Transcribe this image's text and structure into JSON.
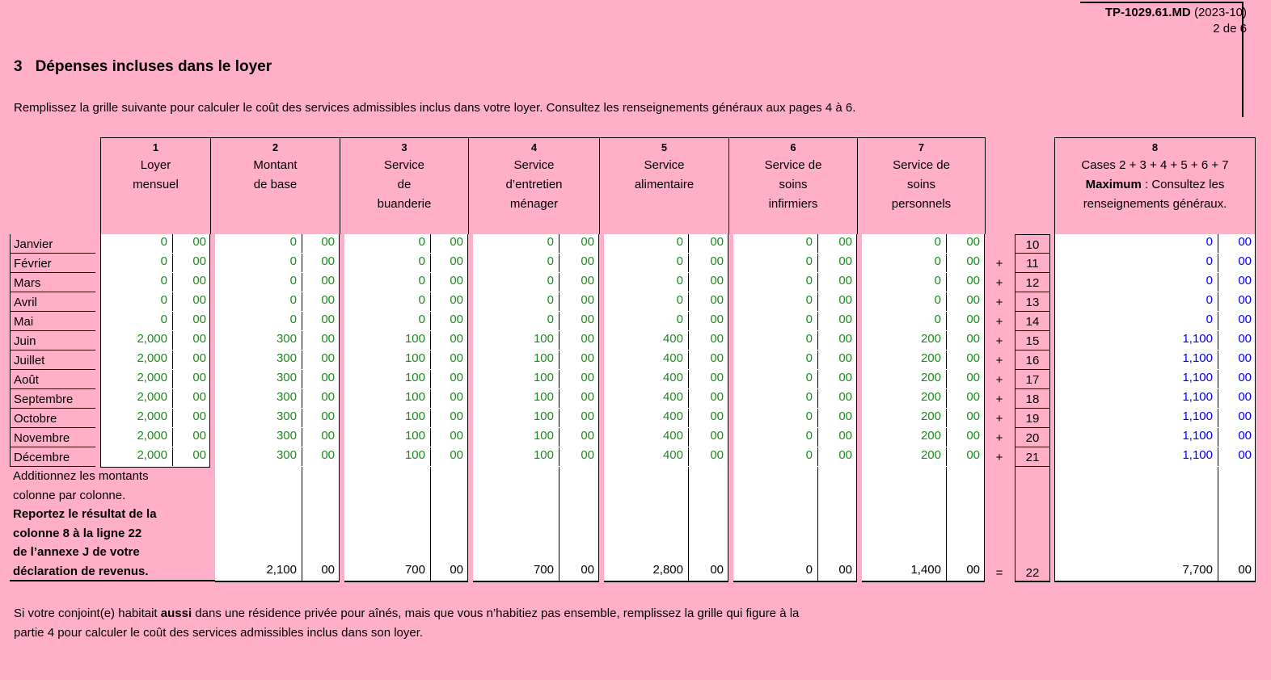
{
  "form": {
    "code": "TP-1029.61.MD",
    "date": "(2023-10)",
    "page": "2 de 6"
  },
  "section": {
    "number": "3",
    "title": "Dépenses incluses dans le loyer",
    "intro": "Remplissez la grille suivante pour calculer le coût des services admissibles inclus dans votre loyer. Consultez les renseignements généraux aux pages 4 à 6."
  },
  "columns": [
    {
      "num": "1",
      "lines": [
        "Loyer",
        "mensuel"
      ]
    },
    {
      "num": "2",
      "lines": [
        "Montant",
        "de base"
      ]
    },
    {
      "num": "3",
      "lines": [
        "Service",
        "de",
        "buanderie"
      ]
    },
    {
      "num": "4",
      "lines": [
        "Service",
        "d’entretien",
        "ménager"
      ]
    },
    {
      "num": "5",
      "lines": [
        "Service",
        "alimentaire"
      ]
    },
    {
      "num": "6",
      "lines": [
        "Service de",
        "soins",
        "infirmiers"
      ]
    },
    {
      "num": "7",
      "lines": [
        "Service de",
        "soins",
        "personnels"
      ]
    }
  ],
  "col8": {
    "num": "8",
    "line1": "Cases 2 + 3 + 4 + 5 + 6 + 7",
    "bold": "Maximum",
    "line2rest": " : Consultez les",
    "line3": "renseignements généraux."
  },
  "rows": [
    {
      "month": "Janvier",
      "line": "10",
      "op": "",
      "vals": [
        "0",
        "0",
        "0",
        "0",
        "0",
        "0",
        "0"
      ],
      "total": "0"
    },
    {
      "month": "Février",
      "line": "11",
      "op": "+",
      "vals": [
        "0",
        "0",
        "0",
        "0",
        "0",
        "0",
        "0"
      ],
      "total": "0"
    },
    {
      "month": "Mars",
      "line": "12",
      "op": "+",
      "vals": [
        "0",
        "0",
        "0",
        "0",
        "0",
        "0",
        "0"
      ],
      "total": "0"
    },
    {
      "month": "Avril",
      "line": "13",
      "op": "+",
      "vals": [
        "0",
        "0",
        "0",
        "0",
        "0",
        "0",
        "0"
      ],
      "total": "0"
    },
    {
      "month": "Mai",
      "line": "14",
      "op": "+",
      "vals": [
        "0",
        "0",
        "0",
        "0",
        "0",
        "0",
        "0"
      ],
      "total": "0"
    },
    {
      "month": "Juin",
      "line": "15",
      "op": "+",
      "vals": [
        "2,000",
        "300",
        "100",
        "100",
        "400",
        "0",
        "200"
      ],
      "total": "1,100"
    },
    {
      "month": "Juillet",
      "line": "16",
      "op": "+",
      "vals": [
        "2,000",
        "300",
        "100",
        "100",
        "400",
        "0",
        "200"
      ],
      "total": "1,100"
    },
    {
      "month": "Août",
      "line": "17",
      "op": "+",
      "vals": [
        "2,000",
        "300",
        "100",
        "100",
        "400",
        "0",
        "200"
      ],
      "total": "1,100"
    },
    {
      "month": "Septembre",
      "line": "18",
      "op": "+",
      "vals": [
        "2,000",
        "300",
        "100",
        "100",
        "400",
        "0",
        "200"
      ],
      "total": "1,100"
    },
    {
      "month": "Octobre",
      "line": "19",
      "op": "+",
      "vals": [
        "2,000",
        "300",
        "100",
        "100",
        "400",
        "0",
        "200"
      ],
      "total": "1,100"
    },
    {
      "month": "Novembre",
      "line": "20",
      "op": "+",
      "vals": [
        "2,000",
        "300",
        "100",
        "100",
        "400",
        "0",
        "200"
      ],
      "total": "1,100"
    },
    {
      "month": "Décembre",
      "line": "21",
      "op": "+",
      "vals": [
        "2,000",
        "300",
        "100",
        "100",
        "400",
        "0",
        "200"
      ],
      "total": "1,100"
    }
  ],
  "cents": "00",
  "totals": {
    "label_lines": [
      "Additionnez les montants",
      "colonne par colonne."
    ],
    "label_bold": [
      "Reportez le résultat de la",
      "colonne 8 à la ligne 22",
      "de l’annexe J de votre",
      "déclaration de revenus."
    ],
    "vals": [
      "2,100",
      "700",
      "700",
      "2,800",
      "0",
      "1,400"
    ],
    "op": "=",
    "line": "22",
    "total": "7,700"
  },
  "footer": {
    "pre": "Si votre conjoint(e) habitait ",
    "bold": "aussi",
    "post": " dans une résidence privée pour aînés, mais que vous n’habitiez pas ensemble, remplissez la grille qui figure à la",
    "line2": "partie 4 pour calculer le coût des services admissibles inclus dans son loyer."
  },
  "colors": {
    "background": "#ffb0c8",
    "entered": "#1a8a1a",
    "computed": "#0000ee"
  }
}
